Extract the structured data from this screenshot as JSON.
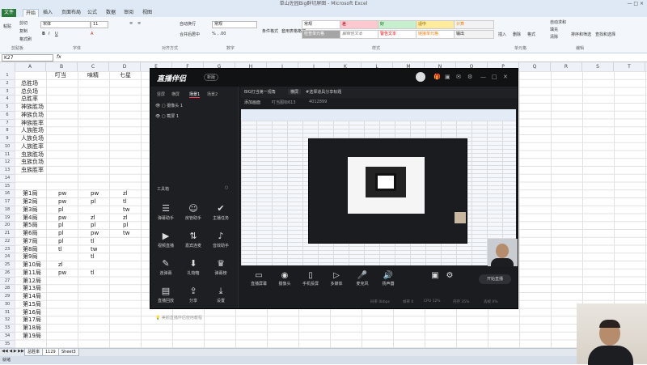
{
  "window": {
    "title": "单山佐园Big群切屏图 - Microsoft Excel",
    "controls": "— □ ×"
  },
  "ribbon": {
    "tabs": [
      "开始",
      "插入",
      "页面布局",
      "公式",
      "数据",
      "审阅",
      "视图"
    ],
    "file_tab": "文件",
    "clipboard": {
      "paste": "粘贴",
      "cut": "剪切",
      "copy": "复制",
      "format_painter": "格式刷",
      "group": "剪贴板"
    },
    "font": {
      "name": "宋体",
      "size": "11",
      "group": "字体"
    },
    "alignment": {
      "wrap": "自动换行",
      "merge": "合并后居中",
      "group": "对齐方式"
    },
    "number": {
      "format": "常规",
      "group": "数字"
    },
    "styles": {
      "cond": "条件格式",
      "table": "套用表格格式",
      "items": [
        "常规",
        "差",
        "好",
        "适中",
        "计算",
        "检查单元格",
        "解释性文本",
        "警告文本",
        "链接单元格",
        "输出"
      ],
      "group": "样式"
    },
    "cells": {
      "insert": "插入",
      "delete": "删除",
      "format": "格式",
      "group": "单元格"
    },
    "editing": {
      "autosum": "自动求和",
      "fill": "填充",
      "clear": "清除",
      "sort": "排序和筛选",
      "find": "查找和选择",
      "group": "编辑"
    }
  },
  "formula_bar": {
    "cell_ref": "K27",
    "fx": "fx"
  },
  "columns": [
    "A",
    "B",
    "C",
    "D",
    "E",
    "F",
    "G",
    "H",
    "I",
    "J",
    "K",
    "L",
    "M",
    "N",
    "O",
    "P",
    "Q",
    "R",
    "S",
    "T",
    "U"
  ],
  "header_row": {
    "b": "叮当",
    "c": "味精",
    "d": "七星"
  },
  "stat_rows": [
    "总胜场",
    "总负场",
    "总胜率",
    "神族胜场",
    "神族负场",
    "神族胜率",
    "人族胜场",
    "人族负场",
    "人族胜率",
    "虫族胜场",
    "虫族负场",
    "虫族胜率"
  ],
  "rounds": [
    {
      "a": "第1局",
      "b": "pw",
      "c": "pw",
      "d": "zl"
    },
    {
      "a": "第2局",
      "b": "pw",
      "c": "pl",
      "d": "tl"
    },
    {
      "a": "第3局",
      "b": "pl",
      "c": "",
      "d": "tw"
    },
    {
      "a": "第4局",
      "b": "pw",
      "c": "zl",
      "d": "zl"
    },
    {
      "a": "第5局",
      "b": "pl",
      "c": "pl",
      "d": "pl"
    },
    {
      "a": "第6局",
      "b": "pl",
      "c": "pw",
      "d": "tw"
    },
    {
      "a": "第7局",
      "b": "pl",
      "c": "tl",
      "d": ""
    },
    {
      "a": "第8局",
      "b": "tl",
      "c": "tw",
      "d": ""
    },
    {
      "a": "第9局",
      "b": "",
      "c": "tl",
      "d": ""
    },
    {
      "a": "第10局",
      "b": "zl",
      "c": "",
      "d": ""
    },
    {
      "a": "第11局",
      "b": "pw",
      "c": "tl",
      "d": ""
    },
    {
      "a": "第12局",
      "b": "",
      "c": "",
      "d": ""
    },
    {
      "a": "第13局",
      "b": "",
      "c": "",
      "d": ""
    },
    {
      "a": "第14局",
      "b": "",
      "c": "",
      "d": ""
    },
    {
      "a": "第15局",
      "b": "",
      "c": "",
      "d": ""
    },
    {
      "a": "第16局",
      "b": "",
      "c": "",
      "d": ""
    },
    {
      "a": "第17局",
      "b": "",
      "c": "",
      "d": ""
    },
    {
      "a": "第18局",
      "b": "",
      "c": "",
      "d": ""
    },
    {
      "a": "第19局",
      "b": "",
      "c": "",
      "d": ""
    }
  ],
  "sheet_tabs": [
    "总胜率",
    "1129",
    "Sheet3"
  ],
  "status": "就绪",
  "stream_app": {
    "logo": "直播伴侣",
    "version": "新版",
    "scene_tabs": [
      "竖屏",
      "横屏",
      "场景1",
      "场景2"
    ],
    "sources": [
      "摄像头 1",
      "截屏 1"
    ],
    "tools_title": "工具箱",
    "tools": [
      "弹幕助手",
      "房管助手",
      "主播任务",
      "视频直播",
      "嘉宾连麦",
      "音效助手",
      "连弹幕",
      "礼物箱",
      "弹幕榜",
      "直播回放",
      "分享",
      "设置"
    ],
    "main_tabs": [
      "BIG打当第一视角",
      "横屏",
      "#选择道具分享标题"
    ],
    "sub_tabs": [
      "添加画面",
      "叮当图标613",
      "4012899"
    ],
    "bottom_actions": [
      "直播屏幕",
      "摄像头",
      "手机投屏",
      "多媒体",
      "麦克风",
      "扬声器"
    ],
    "go_live": "开始直播",
    "hint": "💡 美颜直播伴侣使用教程",
    "stats": [
      "码率 0kbps",
      "帧率 0",
      "CPU 12%",
      "内存 35%",
      "丢帧 0%"
    ]
  }
}
